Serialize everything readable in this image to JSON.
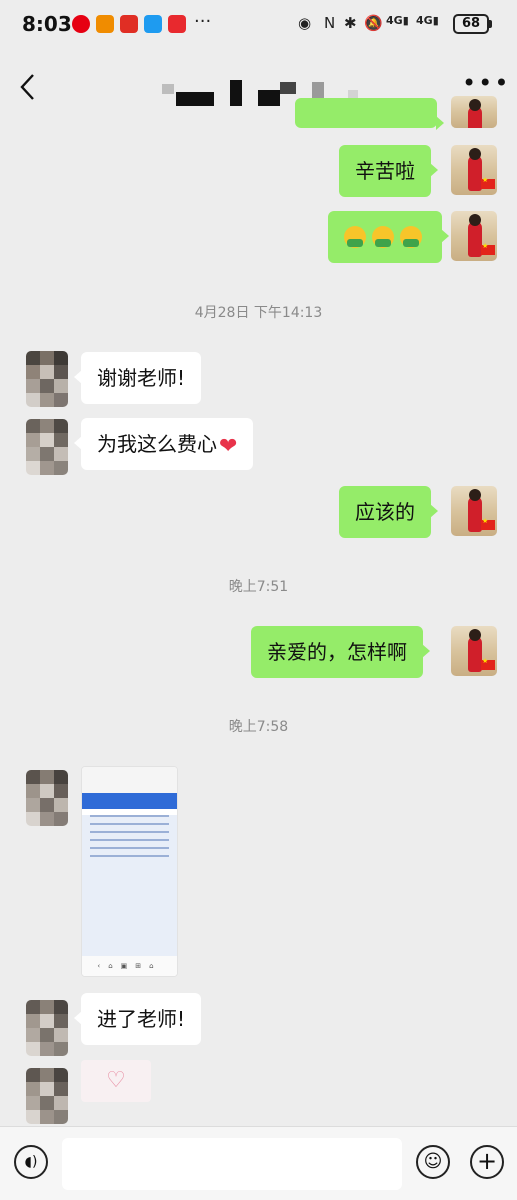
{
  "status_bar": {
    "time": "8:03",
    "network_1": "4G",
    "network_2": "4G",
    "battery": "68"
  },
  "header": {
    "title": "",
    "back_icon": "chevron-left-icon",
    "more_label": "•••"
  },
  "messages": [
    {
      "sender": "me",
      "type": "text",
      "text": "辛苦啦"
    },
    {
      "sender": "me",
      "type": "emoji",
      "count": 3
    },
    {
      "type": "timestamp",
      "text": "4月28日 下午14:13"
    },
    {
      "sender": "other",
      "type": "text",
      "text": "谢谢老师!"
    },
    {
      "sender": "other",
      "type": "text",
      "text": "为我这么费心",
      "emoji": "❤"
    },
    {
      "sender": "me",
      "type": "text",
      "text": "应该的"
    },
    {
      "type": "timestamp",
      "text": "晚上7:51"
    },
    {
      "sender": "me",
      "type": "text",
      "text": "亲爱的，怎样啊"
    },
    {
      "type": "timestamp",
      "text": "晚上7:58"
    },
    {
      "sender": "other",
      "type": "image"
    },
    {
      "sender": "other",
      "type": "text",
      "text": "进了老师!"
    },
    {
      "sender": "other",
      "type": "sticker"
    }
  ],
  "colors": {
    "my_bubble": "#95ec69",
    "other_bubble": "#ffffff",
    "background": "#ededed"
  },
  "input_bar": {
    "placeholder": ""
  }
}
